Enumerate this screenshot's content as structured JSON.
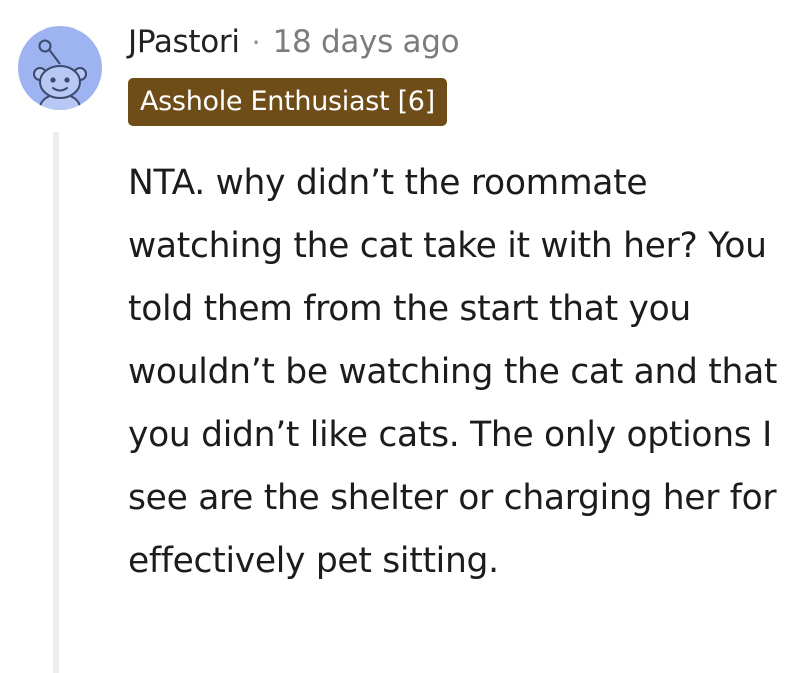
{
  "comment": {
    "avatar_icon": "reddit-snoo-icon",
    "username": "JPastori",
    "separator": "·",
    "timestamp": "18 days ago",
    "flair": "Asshole Enthusiast [6]",
    "body": "NTA. why didn’t the roommate watching the cat take it with her? You told them from the start that you wouldn’t be watching the cat and that you didn’t like cats. The only options I see are the shelter or charging her for effectively pet sitting."
  },
  "colors": {
    "avatar_bg": "#9eb4f0",
    "flair_bg": "#6f4d18",
    "flair_text": "#ffffff",
    "thread_line": "#ececec",
    "timestamp": "#7c7c7c"
  }
}
